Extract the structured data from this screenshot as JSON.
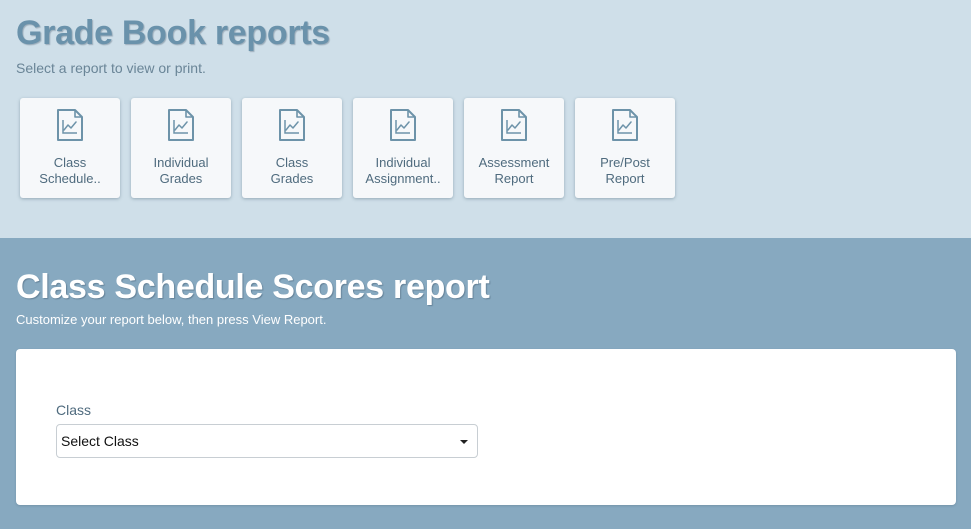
{
  "header": {
    "title": "Grade Book reports",
    "subtitle": "Select a report to view or print."
  },
  "report_tiles": [
    {
      "line1": "Class",
      "line2": "Schedule..",
      "icon": "report-chart-icon"
    },
    {
      "line1": "Individual",
      "line2": "Grades",
      "icon": "report-chart-icon"
    },
    {
      "line1": "Class",
      "line2": "Grades",
      "icon": "report-chart-icon"
    },
    {
      "line1": "Individual",
      "line2": "Assignment..",
      "icon": "report-chart-icon"
    },
    {
      "line1": "Assessment",
      "line2": "Report",
      "icon": "report-chart-icon"
    },
    {
      "line1": "Pre/Post",
      "line2": "Report",
      "icon": "report-chart-icon"
    }
  ],
  "report_section": {
    "title": "Class Schedule Scores report",
    "subtitle": "Customize your report below, then press View Report."
  },
  "form": {
    "class_label": "Class",
    "class_select_value": "Select Class"
  },
  "colors": {
    "top_background": "#cfdfe9",
    "bottom_background": "#87a9c0",
    "title_color": "#6a92ab",
    "tile_text": "#4f6b7e"
  }
}
